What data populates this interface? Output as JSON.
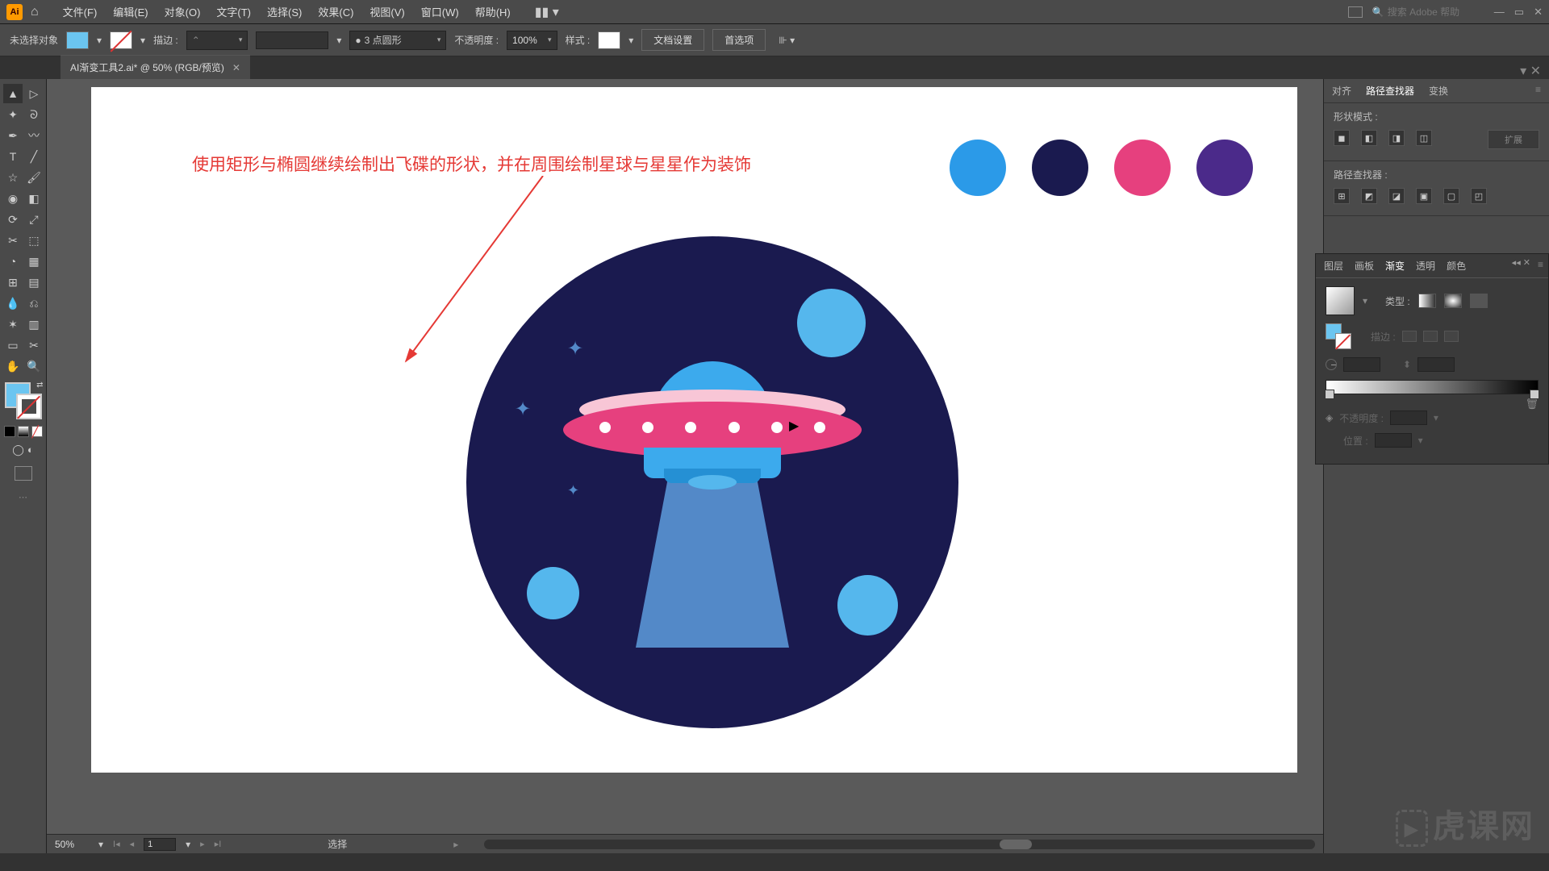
{
  "menubar": {
    "items": [
      "文件(F)",
      "编辑(E)",
      "对象(O)",
      "文字(T)",
      "选择(S)",
      "效果(C)",
      "视图(V)",
      "窗口(W)",
      "帮助(H)"
    ],
    "search_placeholder": "搜索 Adobe 帮助"
  },
  "controlbar": {
    "selection": "未选择对象",
    "stroke_label": "描边 :",
    "stroke_weight": "",
    "brush_name": "3 点圆形",
    "opacity_label": "不透明度 :",
    "opacity_value": "100%",
    "style_label": "样式 :",
    "doc_setup": "文档设置",
    "preferences": "首选项"
  },
  "tab": {
    "title": "AI渐变工具2.ai* @ 50% (RGB/预览)"
  },
  "canvas": {
    "annotation": "使用矩形与椭圆继续绘制出飞碟的形状，并在周围绘制星球与星星作为装饰",
    "palette_colors": [
      "#2b9ae8",
      "#1a1a4f",
      "#e6407e",
      "#4b2a8a"
    ]
  },
  "align_panel": {
    "tabs": [
      "对齐",
      "路径查找器",
      "变换"
    ],
    "active_tab": 1,
    "shape_mode_label": "形状模式 :",
    "pathfinder_label": "路径查找器 :",
    "expand_label": "扩展"
  },
  "grad_panel": {
    "tabs": [
      "图层",
      "画板",
      "渐变",
      "透明",
      "颜色"
    ],
    "active_tab": 2,
    "type_label": "类型 :",
    "stroke_apply_label": "描边 :",
    "opacity_label": "不透明度 :",
    "position_label": "位置 :"
  },
  "statusbar": {
    "zoom": "50%",
    "page": "1",
    "mode": "选择"
  },
  "watermark": "虎课网"
}
